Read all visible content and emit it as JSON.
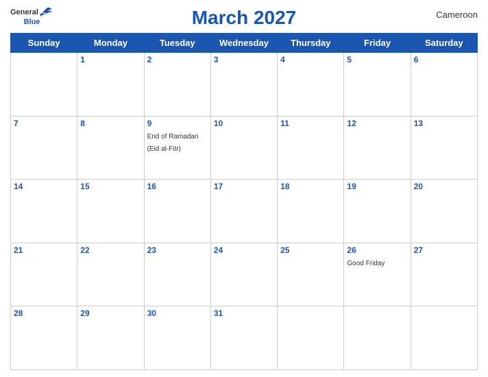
{
  "header": {
    "logo_general": "General",
    "logo_blue": "Blue",
    "title": "March 2027",
    "country": "Cameroon"
  },
  "days_of_week": [
    "Sunday",
    "Monday",
    "Tuesday",
    "Wednesday",
    "Thursday",
    "Friday",
    "Saturday"
  ],
  "weeks": [
    [
      {
        "day": "",
        "events": []
      },
      {
        "day": "1",
        "events": []
      },
      {
        "day": "2",
        "events": []
      },
      {
        "day": "3",
        "events": []
      },
      {
        "day": "4",
        "events": []
      },
      {
        "day": "5",
        "events": []
      },
      {
        "day": "6",
        "events": []
      }
    ],
    [
      {
        "day": "7",
        "events": []
      },
      {
        "day": "8",
        "events": []
      },
      {
        "day": "9",
        "events": [
          "End of Ramadan (Eid al-Fitr)"
        ]
      },
      {
        "day": "10",
        "events": []
      },
      {
        "day": "11",
        "events": []
      },
      {
        "day": "12",
        "events": []
      },
      {
        "day": "13",
        "events": []
      }
    ],
    [
      {
        "day": "14",
        "events": []
      },
      {
        "day": "15",
        "events": []
      },
      {
        "day": "16",
        "events": []
      },
      {
        "day": "17",
        "events": []
      },
      {
        "day": "18",
        "events": []
      },
      {
        "day": "19",
        "events": []
      },
      {
        "day": "20",
        "events": []
      }
    ],
    [
      {
        "day": "21",
        "events": []
      },
      {
        "day": "22",
        "events": []
      },
      {
        "day": "23",
        "events": []
      },
      {
        "day": "24",
        "events": []
      },
      {
        "day": "25",
        "events": []
      },
      {
        "day": "26",
        "events": [
          "Good Friday"
        ]
      },
      {
        "day": "27",
        "events": []
      }
    ],
    [
      {
        "day": "28",
        "events": []
      },
      {
        "day": "29",
        "events": []
      },
      {
        "day": "30",
        "events": []
      },
      {
        "day": "31",
        "events": []
      },
      {
        "day": "",
        "events": []
      },
      {
        "day": "",
        "events": []
      },
      {
        "day": "",
        "events": []
      }
    ]
  ]
}
